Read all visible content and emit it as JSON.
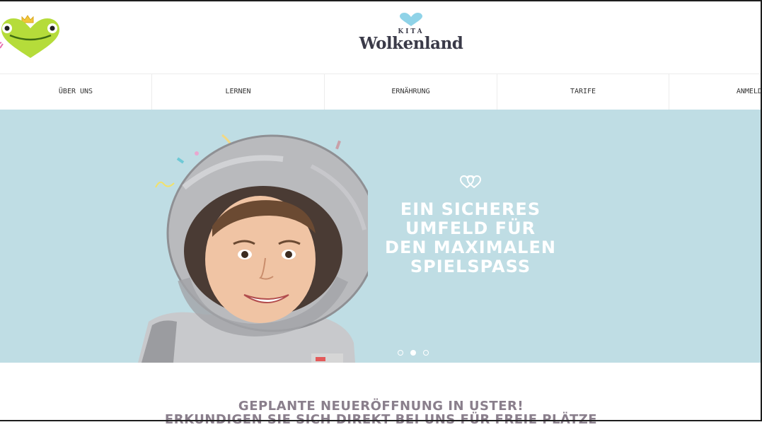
{
  "brand": {
    "kita": "KITA",
    "name": "Wolkenland",
    "heart_color": "#8fd3e8",
    "text_color": "#3a3a48"
  },
  "mascot": {
    "icon": "frog-heart-mascot-icon",
    "color": "#b5dc3a"
  },
  "nav": {
    "items": [
      {
        "label": "ÜBER UNS"
      },
      {
        "label": "LERNEN"
      },
      {
        "label": "ERNÄHRUNG"
      },
      {
        "label": "TARIFE"
      },
      {
        "label": "ANMELD"
      }
    ]
  },
  "hero": {
    "background": "#bfdde4",
    "title_lines": [
      "EIN SICHERES",
      "UMFELD FÜR",
      "DEN MAXIMALEN",
      "SPIELSPASS"
    ],
    "slides": {
      "count": 3,
      "active": 2
    }
  },
  "announcement": {
    "line1": "GEPLANTE NEUERÖFFNUNG IN USTER!",
    "line2": "ERKUNDIGEN SIE SICH DIREKT BEI UNS FÜR FREIE PLÄTZE"
  }
}
